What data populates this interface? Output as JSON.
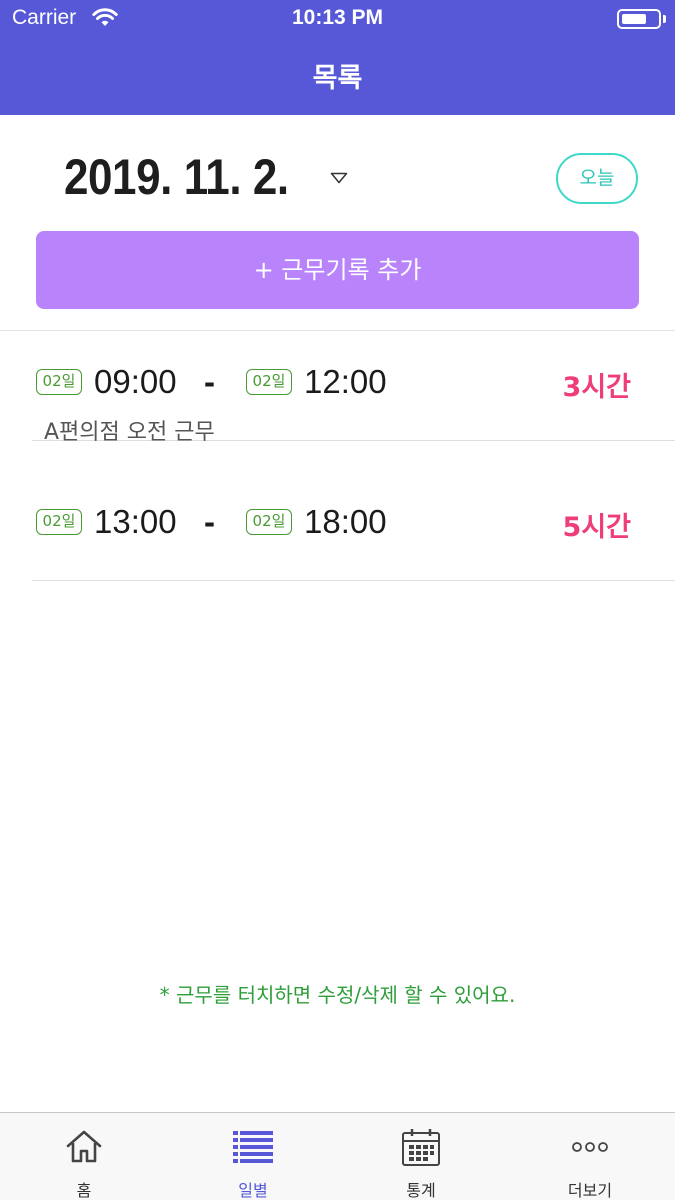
{
  "status_bar": {
    "carrier": "Carrier",
    "time": "10:13 PM"
  },
  "header": {
    "title": "목록"
  },
  "date_row": {
    "date": "2019. 11. 2.",
    "today_label": "오늘"
  },
  "add_button": {
    "label": "+ 근무기록 추가"
  },
  "records": [
    {
      "start_day": "02일",
      "start_time": "09:00",
      "separator": "-",
      "end_day": "02일",
      "end_time": "12:00",
      "hours": "3시간",
      "memo": "A편의점 오전 근무"
    },
    {
      "start_day": "02일",
      "start_time": "13:00",
      "separator": "-",
      "end_day": "02일",
      "end_time": "18:00",
      "hours": "5시간",
      "memo": ""
    }
  ],
  "hint": "* 근무를 터치하면 수정/삭제 할 수 있어요.",
  "tabs": [
    {
      "label": "홈",
      "icon": "home-icon"
    },
    {
      "label": "일별",
      "icon": "list-icon",
      "active": true
    },
    {
      "label": "통계",
      "icon": "calendar-icon"
    },
    {
      "label": "더보기",
      "icon": "more-icon"
    }
  ],
  "colors": {
    "header": "#5658d8",
    "add_button": "#b984fb",
    "today_border": "#3ed8c9",
    "hours": "#ef3d7a",
    "day_badge": "#4a9a33",
    "hint": "#2e9e3a"
  }
}
